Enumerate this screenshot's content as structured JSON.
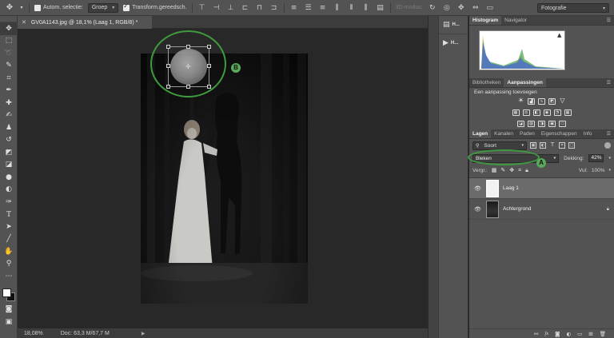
{
  "options_bar": {
    "auto_select_label": "Autom. selectie:",
    "auto_select_value": "Groep",
    "transform_label": "Transform.gereedsch.",
    "mode_3d_label": "3D-modus:",
    "workspace_value": "Fotografie"
  },
  "document": {
    "tab_title": "GV0A1143.jpg @ 18,1% (Laag 1, RGB/8) *",
    "zoom": "18,08%",
    "doc_info": "Doc: 63,3 M/67,7 M"
  },
  "annotations": {
    "a_label": "A",
    "b_label": "B",
    "accent_color": "#3f9a3f"
  },
  "middle_panel": {
    "items": [
      {
        "icon": "history-icon",
        "label": "H..."
      },
      {
        "icon": "play-icon",
        "label": "H..."
      }
    ]
  },
  "histogram_panel": {
    "tabs": [
      "Histogram",
      "Navigator"
    ]
  },
  "adjustments_panel": {
    "tabs": [
      "Bibliotheken",
      "Aanpassingen"
    ],
    "title": "Een aanpassing toevoegen"
  },
  "layers_panel": {
    "tabs": [
      "Lagen",
      "Kanalen",
      "Paden",
      "Eigenschappen",
      "Info"
    ],
    "filter_value": "Soort",
    "blend_mode": "Bleken",
    "opacity_label": "Dekking:",
    "opacity_value": "42%",
    "lock_label": "Vergr.:",
    "fill_label": "Vul:",
    "fill_value": "100%",
    "layers": [
      {
        "name": "Laag 1",
        "selected": true
      },
      {
        "name": "Achtergrond",
        "selected": false
      }
    ]
  }
}
